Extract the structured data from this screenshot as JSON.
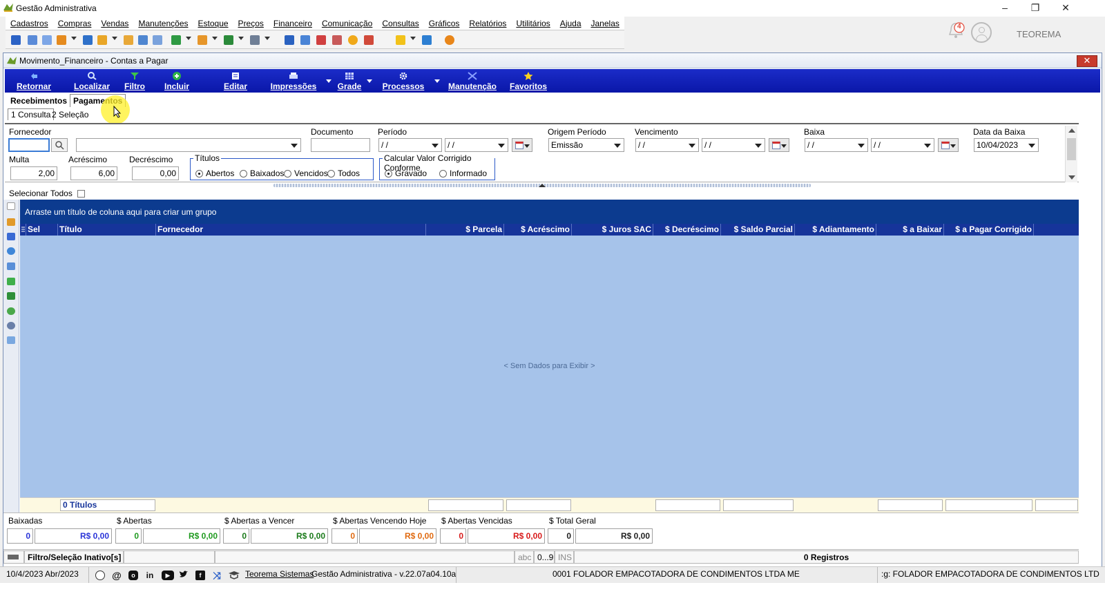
{
  "app": {
    "title": "Gestão Administrativa"
  },
  "menu": [
    "Cadastros",
    "Compras",
    "Vendas",
    "Manutenções",
    "Estoque",
    "Preços",
    "Financeiro",
    "Comunicação",
    "Consultas",
    "Gráficos",
    "Relatórios",
    "Utilitários",
    "Ajuda",
    "Janelas"
  ],
  "topright": {
    "notifications": "4",
    "user": "TEOREMA"
  },
  "window": {
    "title": "Movimento_Financeiro - Contas a Pagar",
    "close": "✕"
  },
  "actions": [
    {
      "label": "Retornar",
      "icon": "return-icon",
      "color": "#7fb2ff"
    },
    {
      "label": "Localizar",
      "icon": "search-icon",
      "color": "#d6e6ff"
    },
    {
      "label": "Filtro",
      "icon": "filter-icon",
      "color": "#3ec24a"
    },
    {
      "label": "Incluir",
      "icon": "add-icon",
      "color": "#2fb348"
    },
    {
      "label": "Editar",
      "icon": "edit-icon",
      "color": "#ffffff"
    },
    {
      "label": "Impressões",
      "icon": "printer-icon",
      "color": "#d0d8ff"
    },
    {
      "label": "Grade",
      "icon": "grid-icon",
      "color": "#d0d8ff"
    },
    {
      "label": "Processos",
      "icon": "gear-icon",
      "color": "#ffffff"
    },
    {
      "label": "Manutenção",
      "icon": "tools-icon",
      "color": "#8aa0ff"
    },
    {
      "label": "Favoritos",
      "icon": "star-icon",
      "color": "#ffd21e"
    }
  ],
  "tabs": {
    "main": [
      "Recebimentos",
      "Pagamentos"
    ],
    "sub": [
      "1 Consulta",
      "2 Seleção"
    ]
  },
  "filters": {
    "fornecedor_label": "Fornecedor",
    "documento_label": "Documento",
    "periodo_label": "Período",
    "periodo_de": "/ /",
    "periodo_ate": "/ /",
    "origem_label": "Origem Período",
    "origem_value": "Emissão",
    "vencimento_label": "Vencimento",
    "vencimento_de": "/ /",
    "vencimento_ate": "/ /",
    "baixa_label": "Baixa",
    "baixa_de": "/ /",
    "baixa_ate": "/ /",
    "data_baixa_label": "Data da Baixa",
    "data_baixa_value": "10/04/2023",
    "multa_label": "Multa",
    "multa_value": "2,00",
    "acrescimo_label": "Acréscimo",
    "acrescimo_value": "6,00",
    "decrescimo_label": "Decréscimo",
    "decrescimo_value": "0,00",
    "titulos_label": "Títulos",
    "titulos_options": [
      "Abertos",
      "Baixados",
      "Vencidos",
      "Todos"
    ],
    "calcular_label": "Calcular Valor Corrigido Conforme",
    "calcular_options": [
      "Gravado",
      "Informado"
    ]
  },
  "select_all": "Selecionar Todos",
  "grid": {
    "group_hint": "Arraste um título de coluna aqui para criar um grupo",
    "columns": [
      "Sel",
      "Título",
      "Fornecedor",
      "$ Parcela",
      "$ Acréscimo",
      "$ Juros SAC",
      "$ Decréscimo",
      "$ Saldo Parcial",
      "$ Adiantamento",
      "$ a Baixar",
      "$ a Pagar Corrigido"
    ],
    "empty": "< Sem Dados para Exibir >",
    "footer_count": "0 Títulos"
  },
  "totals": [
    {
      "label": "Baixadas",
      "count": "0",
      "value": "R$ 0,00",
      "color": "#2a34d8"
    },
    {
      "label": "$ Abertas",
      "count": "0",
      "value": "R$ 0,00",
      "color": "#1f9a1f"
    },
    {
      "label": "$ Abertas a Vencer",
      "count": "0",
      "value": "R$ 0,00",
      "color": "#1a7a1a"
    },
    {
      "label": "$ Abertas Vencendo Hoje",
      "count": "0",
      "value": "R$ 0,00",
      "color": "#e06a10"
    },
    {
      "label": "$ Abertas Vencidas",
      "count": "0",
      "value": "R$ 0,00",
      "color": "#d81a1a"
    },
    {
      "label": "$ Total Geral",
      "count": "0",
      "value": "R$ 0,00",
      "color": "#222222"
    }
  ],
  "status": {
    "filter": "Filtro/Seleção Inativo[s]",
    "abc": "abc",
    "num": "0...9",
    "ins": "INS",
    "records": "0 Registros"
  },
  "bottom": {
    "date": "10/4/2023 Abr/2023",
    "company_link": "Teorema Sistemas",
    "version": "Gestão Administrativa - v.22.07a04.10a",
    "company": "0001 FOLADOR EMPACOTADORA DE CONDIMENTOS LTDA ME",
    "company_right": ":g: FOLADOR EMPACOTADORA DE CONDIMENTOS LTD"
  }
}
